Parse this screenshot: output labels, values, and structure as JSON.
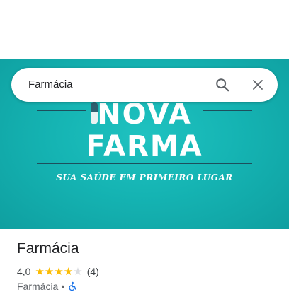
{
  "search": {
    "query": "Farmácia"
  },
  "banner": {
    "line1": "NOVA",
    "line2": "FARMA",
    "tagline": "SUA SAÚDE EM PRIMEIRO LUGAR",
    "bg_color": "#15b4b3"
  },
  "place": {
    "name": "Farmácia",
    "rating": "4,0",
    "stars_filled": 4,
    "stars_total": 5,
    "review_count": "(4)",
    "category": "Farmácia",
    "separator": "•",
    "accessibility_icon": "wheelchair-icon"
  },
  "colors": {
    "star": "#fbbc04",
    "star_empty": "#dadce0",
    "accent_dark": "#1d4f5c"
  }
}
